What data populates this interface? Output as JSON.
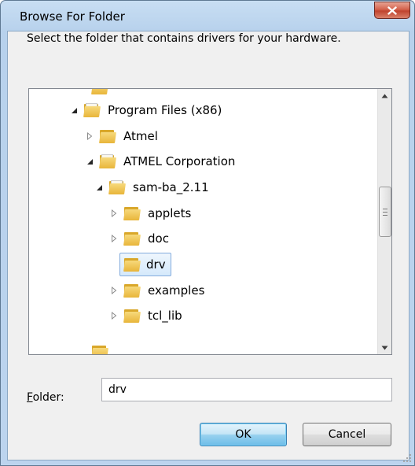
{
  "window": {
    "title": "Browse For Folder"
  },
  "dialog": {
    "prompt": "Select the folder that contains drivers for your hardware.",
    "folder_label_prefix": "F",
    "folder_label_rest": "older:",
    "folder_value": "drv",
    "ok_label": "OK",
    "cancel_label": "Cancel"
  },
  "tree": {
    "items": [
      {
        "label": "Program Files (x86)",
        "expander": "expanded"
      },
      {
        "label": "Atmel",
        "expander": "collapsed"
      },
      {
        "label": "ATMEL Corporation",
        "expander": "expanded"
      },
      {
        "label": "sam-ba_2.11",
        "expander": "expanded"
      },
      {
        "label": "applets",
        "expander": "collapsed"
      },
      {
        "label": "doc",
        "expander": "collapsed"
      },
      {
        "label": "drv",
        "expander": "none",
        "selected": true
      },
      {
        "label": "examples",
        "expander": "collapsed"
      },
      {
        "label": "tcl_lib",
        "expander": "collapsed"
      }
    ]
  },
  "icons": {
    "close": "close-icon",
    "folder": "folder-icon",
    "expanded": "tree-expanded-icon",
    "collapsed": "tree-collapsed-icon",
    "scroll_up": "scroll-up-icon",
    "scroll_down": "scroll-down-icon",
    "grip": "resize-grip-icon"
  },
  "colors": {
    "titlebar": "#c8def3",
    "close_button": "#c7432e",
    "selection": "#d5e9fb",
    "selection_border": "#84acdd",
    "default_button": "#98d1ef"
  }
}
